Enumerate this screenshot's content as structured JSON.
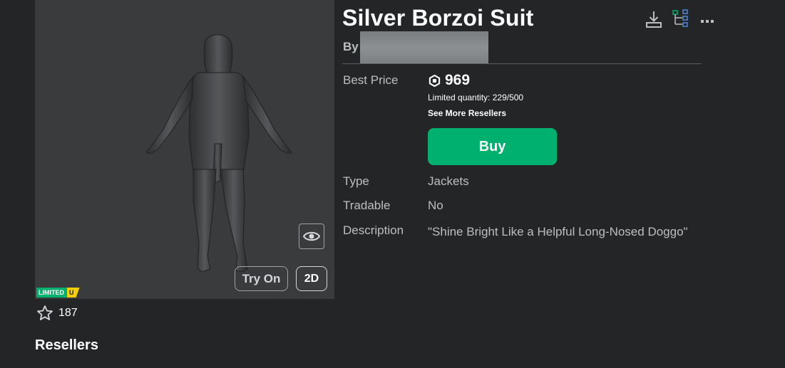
{
  "item": {
    "title": "Silver Borzoi Suit",
    "by_label": "By",
    "favorite_count": "187"
  },
  "thumbnail": {
    "try_on_label": "Try On",
    "view_2d_label": "2D",
    "badge_limited": "LIMITED",
    "badge_unique": "U"
  },
  "icons": {
    "download": "download-icon",
    "hierarchy": "hierarchy-icon",
    "more": "more-options-icon",
    "eye": "eye-icon",
    "star": "star-icon",
    "robux": "robux-icon"
  },
  "price": {
    "label": "Best Price",
    "amount": "969",
    "limited_quantity": "Limited quantity: 229/500",
    "see_more": "See More Resellers",
    "buy_label": "Buy"
  },
  "details": {
    "type_label": "Type",
    "type_value": "Jackets",
    "tradable_label": "Tradable",
    "tradable_value": "No",
    "description_label": "Description",
    "description_value": "\"Shine Bright Like a Helpful Long-Nosed Doggo\""
  },
  "sections": {
    "resellers_heading": "Resellers"
  },
  "colors": {
    "background": "#232527",
    "panel": "#393b3d",
    "buy_green": "#00b06f",
    "limited_green": "#00b06f",
    "unique_yellow": "#f6d000",
    "secondary_text": "#bdbebe"
  }
}
